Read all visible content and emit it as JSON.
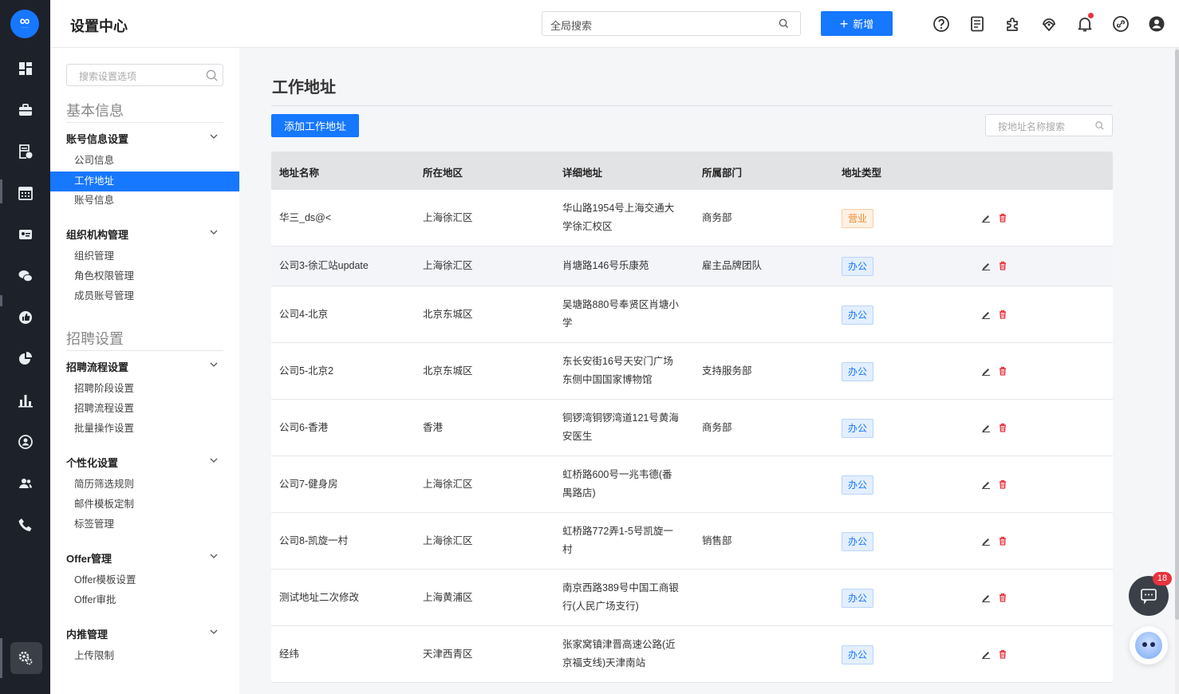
{
  "header": {
    "title": "设置中心",
    "search_placeholder": "全局搜索",
    "new_label": "新增",
    "icons": [
      "help-icon",
      "document-icon",
      "plugin-icon",
      "support-icon",
      "bell-icon",
      "link-icon",
      "user-icon"
    ]
  },
  "sidebar": {
    "search_placeholder": "搜索设置选项",
    "sections": [
      {
        "title": "基本信息",
        "groups": [
          {
            "label": "账号信息设置",
            "items": [
              "公司信息",
              "工作地址",
              "账号信息"
            ]
          },
          {
            "label": "组织机构管理",
            "items": [
              "组织管理",
              "角色权限管理",
              "成员账号管理"
            ]
          }
        ]
      },
      {
        "title": "招聘设置",
        "groups": [
          {
            "label": "招聘流程设置",
            "items": [
              "招聘阶段设置",
              "招聘流程设置",
              "批量操作设置"
            ]
          },
          {
            "label": "个性化设置",
            "items": [
              "简历筛选规则",
              "邮件模板定制",
              "标签管理"
            ]
          },
          {
            "label": "Offer管理",
            "items": [
              "Offer模板设置",
              "Offer审批"
            ]
          },
          {
            "label": "内推管理",
            "items": [
              "上传限制"
            ]
          }
        ]
      }
    ],
    "active_item": "工作地址"
  },
  "main": {
    "title": "工作地址",
    "add_button": "添加工作地址",
    "search_placeholder": "按地址名称搜索",
    "columns": [
      "地址名称",
      "所在地区",
      "详细地址",
      "所属部门",
      "地址类型"
    ],
    "rows": [
      {
        "name": "华三_ds@<",
        "region": "上海徐汇区",
        "addr1": "华山路1954号上海交通大",
        "addr2": "学徐汇校区",
        "dept": "商务部",
        "type": "营业"
      },
      {
        "name": "公司3-徐汇站update",
        "region": "上海徐汇区",
        "addr1": "肖塘路146号乐康苑",
        "addr2": "",
        "dept": "雇主品牌团队",
        "type": "办公"
      },
      {
        "name": "公司4-北京",
        "region": "北京东城区",
        "addr1": "吴塘路880号奉贤区肖塘小",
        "addr2": "学",
        "dept": "",
        "type": "办公"
      },
      {
        "name": "公司5-北京2",
        "region": "北京东城区",
        "addr1": "东长安街16号天安门广场",
        "addr2": "东侧中国国家博物馆",
        "dept": "支持服务部",
        "type": "办公"
      },
      {
        "name": "公司6-香港",
        "region": "香港",
        "addr1": "铜锣湾铜锣湾道121号黄海",
        "addr2": "安医生",
        "dept": "商务部",
        "type": "办公"
      },
      {
        "name": "公司7-健身房",
        "region": "上海徐汇区",
        "addr1": "虹桥路600号一兆韦德(番",
        "addr2": "禺路店)",
        "dept": "",
        "type": "办公"
      },
      {
        "name": "公司8-凯旋一村",
        "region": "上海徐汇区",
        "addr1": "虹桥路772弄1-5号凯旋一",
        "addr2": "村",
        "dept": "销售部",
        "type": "办公"
      },
      {
        "name": "测试地址二次修改",
        "region": "上海黄浦区",
        "addr1": "南京西路389号中国工商银",
        "addr2": "行(人民广场支行)",
        "dept": "",
        "type": "办公"
      },
      {
        "name": "经纬",
        "region": "天津西青区",
        "addr1": "张家窝镇津晋高速公路(近",
        "addr2": "京福支线)天津南站",
        "dept": "",
        "type": "办公"
      }
    ]
  },
  "chat": {
    "badge_count": "18"
  },
  "colors": {
    "primary": "#1677ff",
    "rail": "#1d2129",
    "tag_business": "#ef8a2c",
    "delete": "#e8323c"
  }
}
